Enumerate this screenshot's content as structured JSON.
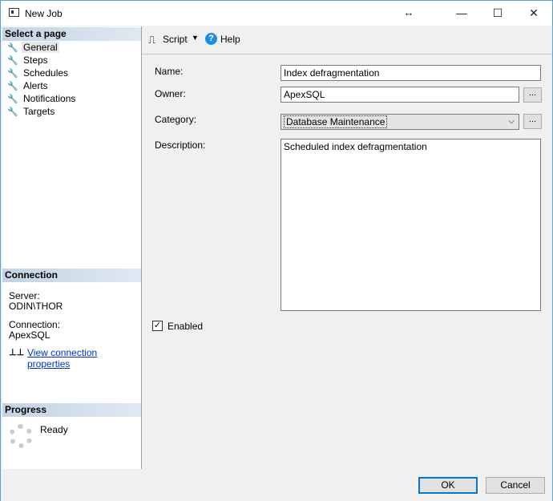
{
  "window": {
    "title": "New Job",
    "minimize": "—",
    "maximize": "☐",
    "close": "✕",
    "resize": "↔"
  },
  "sidebar": {
    "select_header": "Select a page",
    "items": [
      {
        "label": "General"
      },
      {
        "label": "Steps"
      },
      {
        "label": "Schedules"
      },
      {
        "label": "Alerts"
      },
      {
        "label": "Notifications"
      },
      {
        "label": "Targets"
      }
    ],
    "connection_header": "Connection",
    "server_label": "Server:",
    "server_value": "ODIN\\THOR",
    "connection_label": "Connection:",
    "connection_value": "ApexSQL",
    "view_link": "View connection properties",
    "progress_header": "Progress",
    "progress_status": "Ready"
  },
  "toolbar": {
    "script": "Script",
    "help": "Help"
  },
  "form": {
    "name_label": "Name:",
    "name_value": "Index defragmentation",
    "owner_label": "Owner:",
    "owner_value": "ApexSQL",
    "category_label": "Category:",
    "category_value": "Database Maintenance",
    "description_label": "Description:",
    "description_value": "Scheduled index defragmentation",
    "enabled_label": "Enabled",
    "enabled": true,
    "browse": "..."
  },
  "buttons": {
    "ok": "OK",
    "cancel": "Cancel"
  }
}
